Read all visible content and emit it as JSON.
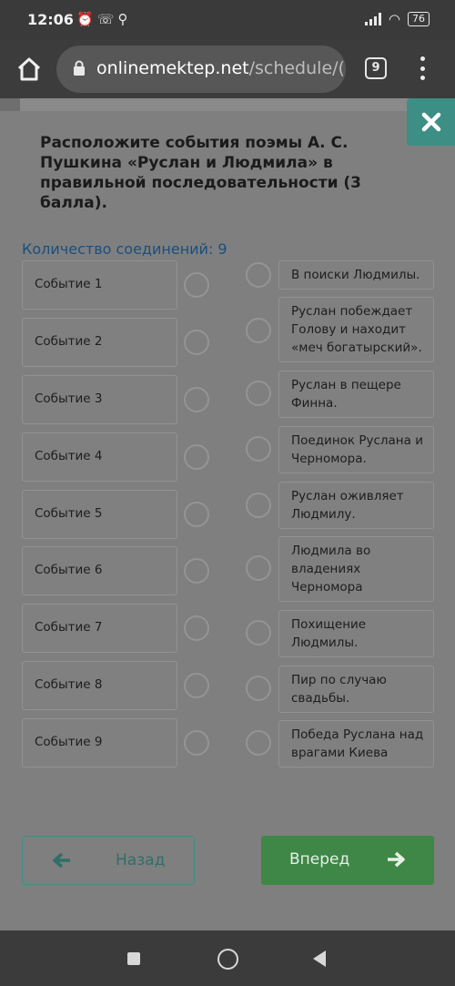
{
  "status_bar": {
    "time": "12:06",
    "icons": [
      "alarm-icon",
      "call-icon",
      "search-icon"
    ],
    "battery": "76"
  },
  "browser": {
    "url_domain": "onlinemektep.net",
    "url_path": "/schedule/(",
    "tab_count": "9"
  },
  "question": {
    "text": "Расположите события поэмы А. С. Пушкина «Руслан и Людмила» в правильной последовательности (3 балла).",
    "connections_label": "Количество соединений: 9"
  },
  "events": [
    {
      "label": "Событие 1"
    },
    {
      "label": "Событие 2"
    },
    {
      "label": "Событие 3"
    },
    {
      "label": "Событие 4"
    },
    {
      "label": "Событие 5"
    },
    {
      "label": "Событие 6"
    },
    {
      "label": "Событие 7"
    },
    {
      "label": "Событие 8"
    },
    {
      "label": "Событие 9"
    }
  ],
  "answers": [
    {
      "text": "В поиски Людмилы."
    },
    {
      "text": "Руслан побеждает Голову и находит «меч богатырский»."
    },
    {
      "text": "Руслан в пещере Финна."
    },
    {
      "text": "Поединок Руслана и Черномора."
    },
    {
      "text": "Руслан оживляет Людмилу."
    },
    {
      "text": "Людмила во владениях Черномора"
    },
    {
      "text": "Похищение Людмилы."
    },
    {
      "text": "Пир по случаю свадьбы."
    },
    {
      "text": "Победа Руслана над врагами Киева"
    }
  ],
  "navigation": {
    "back_label": "Назад",
    "next_label": "Вперед"
  },
  "colors": {
    "accent_teal": "#3d8f86",
    "next_green": "#3e8746",
    "link_blue": "#1a4f7e"
  }
}
